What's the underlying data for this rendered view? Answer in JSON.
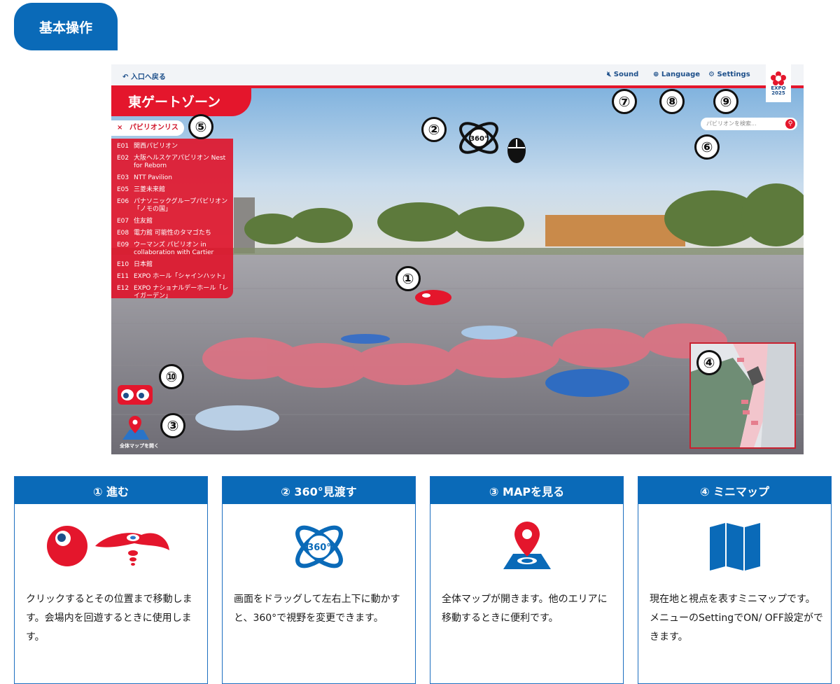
{
  "section_tab": "基本操作",
  "screen": {
    "back_link": "入口へ戻る",
    "sound": "Sound",
    "language": "Language",
    "settings": "Settings",
    "logo_text": "EXPO\n2025",
    "zone_title": "東ゲートゾーン",
    "pavilion_list_title": "パビリオンリスト",
    "pavilion_close": "×",
    "pavilions": [
      {
        "code": "E01",
        "name": "関西パビリオン"
      },
      {
        "code": "E02",
        "name": "大阪ヘルスケアパビリオン Nest for Reborn"
      },
      {
        "code": "E03",
        "name": "NTT Pavilion"
      },
      {
        "code": "E05",
        "name": "三菱未来館"
      },
      {
        "code": "E06",
        "name": "パナソニックグループパビリオン「ノモの国」"
      },
      {
        "code": "E07",
        "name": "住友館"
      },
      {
        "code": "E08",
        "name": "電力館 可能性のタマゴたち"
      },
      {
        "code": "E09",
        "name": "ウーマンズ パビリオン in collaboration with Cartier"
      },
      {
        "code": "E10",
        "name": "日本館"
      },
      {
        "code": "E11",
        "name": "EXPO ホール「シャインハット」"
      },
      {
        "code": "E12",
        "name": "EXPO ナショナルデーホール「レイガーデン」"
      }
    ],
    "search_placeholder": "パビリオンを検索...",
    "icon_360": "360°",
    "map_button_label": "全体マップを開く",
    "markers": [
      "①",
      "②",
      "③",
      "④",
      "⑤",
      "⑥",
      "⑦",
      "⑧",
      "⑨",
      "⑩"
    ]
  },
  "cards": [
    {
      "title": "① 進む",
      "text": "クリックするとその位置まで移動します。会場内を回遊するときに使用します。",
      "icon": "red-circle-move-icon"
    },
    {
      "title": "② 360°見渡す",
      "text": "画面をドラッグして左右上下に動かすと、360°で視野を変更できます。",
      "icon": "rotate-360-icon",
      "icon_label": "360°"
    },
    {
      "title": "③ MAPを見る",
      "text": "全体マップが開きます。他のエリアに移動するときに便利です。",
      "icon": "map-pin-icon"
    },
    {
      "title": "④ ミニマップ",
      "text": "現在地と視点を表すミニマップです。メニューのSettingでON/ OFF設定ができます。",
      "icon": "folded-map-icon"
    }
  ],
  "colors": {
    "brand_blue": "#0a6ab8",
    "expo_red": "#e4162c"
  }
}
